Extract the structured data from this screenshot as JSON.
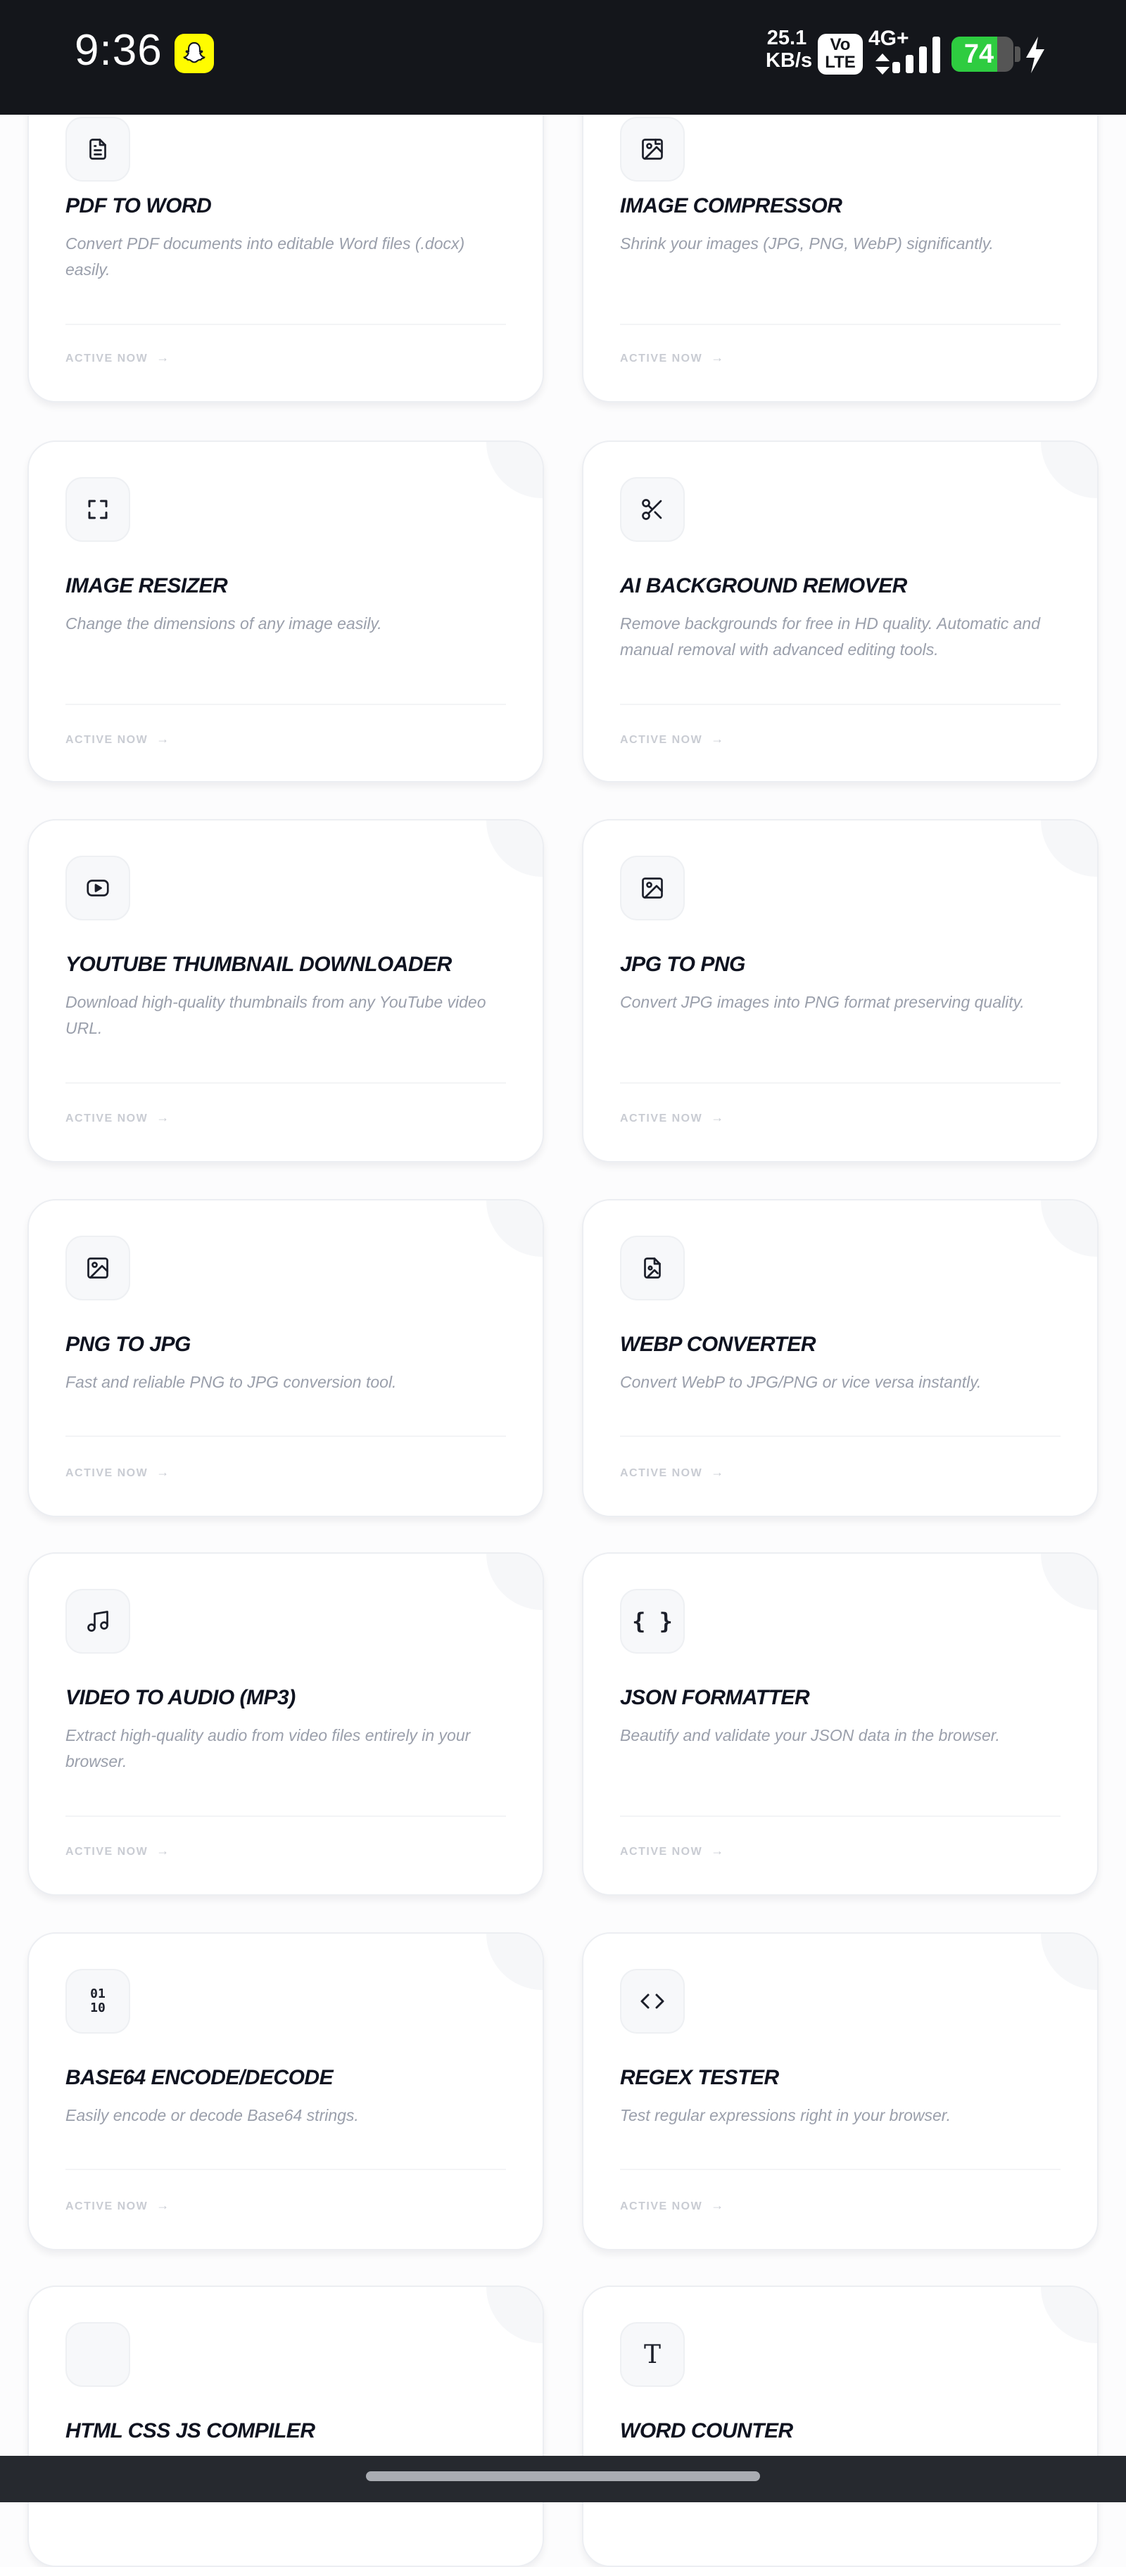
{
  "status_bar": {
    "time": "9:36",
    "speed_value": "25.1",
    "speed_unit": "KB/s",
    "volte_top": "Vo",
    "volte_bottom": "LTE",
    "network": "4G+",
    "battery": "74",
    "battery_level": 0.74
  },
  "cards": [
    {
      "title": "PDF TO WORD",
      "desc": "Convert PDF documents into editable Word files (.docx) easily.",
      "cta": "ACTIVE NOW",
      "icon": "file-text-icon"
    },
    {
      "title": "IMAGE COMPRESSOR",
      "desc": "Shrink your images (JPG, PNG, WebP) significantly.",
      "cta": "ACTIVE NOW",
      "icon": "image-compress-icon"
    },
    {
      "title": "IMAGE RESIZER",
      "desc": "Change the dimensions of any image easily.",
      "cta": "ACTIVE NOW",
      "icon": "resize-icon"
    },
    {
      "title": "AI BACKGROUND REMOVER",
      "desc": "Remove backgrounds for free in HD quality. Automatic and manual removal with advanced editing tools.",
      "cta": "ACTIVE NOW",
      "icon": "scissors-icon"
    },
    {
      "title": "YOUTUBE THUMBNAIL DOWNLOADER",
      "desc": "Download high-quality thumbnails from any YouTube video URL.",
      "cta": "ACTIVE NOW",
      "icon": "youtube-icon"
    },
    {
      "title": "JPG TO PNG",
      "desc": "Convert JPG images into PNG format preserving quality.",
      "cta": "ACTIVE NOW",
      "icon": "image-icon"
    },
    {
      "title": "PNG TO JPG",
      "desc": "Fast and reliable PNG to JPG conversion tool.",
      "cta": "ACTIVE NOW",
      "icon": "image-icon"
    },
    {
      "title": "WEBP CONVERTER",
      "desc": "Convert WebP to JPG/PNG or vice versa instantly.",
      "cta": "ACTIVE NOW",
      "icon": "file-image-icon"
    },
    {
      "title": "VIDEO TO AUDIO (MP3)",
      "desc": "Extract high-quality audio from video files entirely in your browser.",
      "cta": "ACTIVE NOW",
      "icon": "music-icon"
    },
    {
      "title": "JSON FORMATTER",
      "desc": "Beautify and validate your JSON data in the browser.",
      "cta": "ACTIVE NOW",
      "icon": "braces-icon"
    },
    {
      "title": "BASE64 ENCODE/DECODE",
      "desc": "Easily encode or decode Base64 strings.",
      "cta": "ACTIVE NOW",
      "icon": "binary-icon"
    },
    {
      "title": "REGEX TESTER",
      "desc": "Test regular expressions right in your browser.",
      "cta": "ACTIVE NOW",
      "icon": "code-icon"
    },
    {
      "title": "HTML CSS JS COMPILER",
      "desc": "",
      "cta": "",
      "icon": ""
    },
    {
      "title": "WORD COUNTER",
      "desc": "",
      "cta": "",
      "icon": "type-icon"
    }
  ],
  "binary_glyph": {
    "top": "01",
    "bottom": "10"
  },
  "type_glyph": "T",
  "braces_glyph": "{ }"
}
